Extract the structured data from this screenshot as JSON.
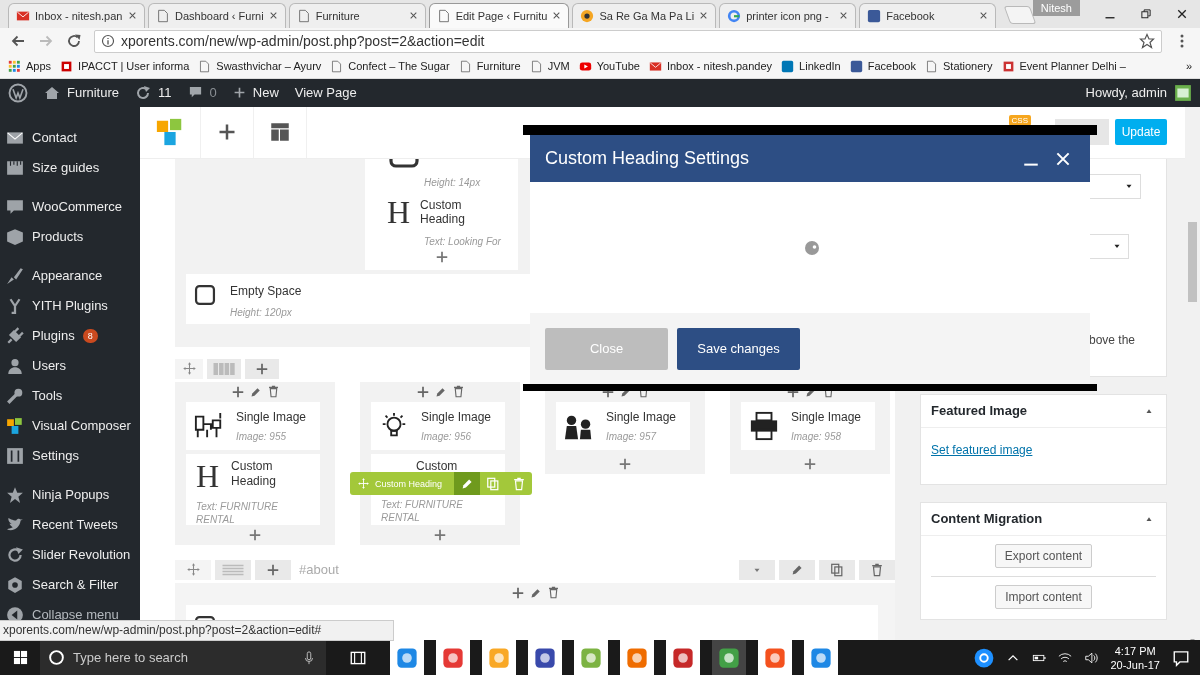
{
  "browser": {
    "tabs": [
      {
        "title": "Inbox - nitesh.pan",
        "selected": false
      },
      {
        "title": "Dashboard ‹ Furni",
        "selected": false
      },
      {
        "title": "Furniture",
        "selected": false
      },
      {
        "title": "Edit Page ‹ Furnitu",
        "selected": true
      },
      {
        "title": "Sa Re Ga Ma Pa Li",
        "selected": false
      },
      {
        "title": "printer icon png -",
        "selected": false
      },
      {
        "title": "Facebook",
        "selected": false
      }
    ],
    "profile": "Nitesh",
    "address": "xporents.com/new/wp-admin/post.php?post=2&action=edit",
    "bookmarks": [
      "Apps",
      "IPACCT | User informa",
      "Swasthvichar – Ayurv",
      "Confect – The Sugar",
      "Furniture",
      "JVM",
      "YouTube",
      "Inbox - nitesh.pandey",
      "LinkedIn",
      "Facebook",
      "Stationery",
      "Event Planner Delhi –"
    ],
    "bookmarks_more": "»"
  },
  "admin_bar": {
    "site": "Furniture",
    "updates": "11",
    "comments": "0",
    "new": "New",
    "view": "View Page",
    "greeting": "Howdy, admin"
  },
  "sidebar": {
    "items": [
      {
        "label": "Contact"
      },
      {
        "label": "Size guides"
      },
      {
        "label": "WooCommerce"
      },
      {
        "label": "Products"
      },
      {
        "label": "Appearance"
      },
      {
        "label": "YITH Plugins"
      },
      {
        "label": "Plugins",
        "badge": "8"
      },
      {
        "label": "Users"
      },
      {
        "label": "Tools"
      },
      {
        "label": "Visual Composer"
      },
      {
        "label": "Settings"
      },
      {
        "label": "Ninja Popups"
      },
      {
        "label": "Recent Tweets"
      },
      {
        "label": "Slider Revolution"
      },
      {
        "label": "Search & Filter"
      },
      {
        "label": "Collapse menu"
      }
    ]
  },
  "builder": {
    "css_badge": "CSS",
    "update": "Update",
    "top_column": {
      "spacer_subtitle": "Height: 14px",
      "heading": {
        "icon_text": "H",
        "title": "Custom Heading",
        "subtitle": "Text: Looking For"
      }
    },
    "empty_space": {
      "title": "Empty Space",
      "subtitle": "Height: 120px"
    },
    "columns": [
      {
        "elements": [
          {
            "kind": "image",
            "title": "Single Image",
            "subtitle": "Image: 955"
          },
          {
            "kind": "heading",
            "icon_text": "H",
            "title": "Custom Heading",
            "subtitle": "Text: FURNITURE RENTAL"
          }
        ]
      },
      {
        "elements": [
          {
            "kind": "image",
            "title": "Single Image",
            "subtitle": "Image: 956"
          },
          {
            "kind": "heading",
            "title": "Custom",
            "subtitle": "Text: FURNITURE RENTAL"
          }
        ]
      },
      {
        "elements": [
          {
            "kind": "image",
            "title": "Single Image",
            "subtitle": "Image: 957"
          }
        ]
      },
      {
        "elements": [
          {
            "kind": "image",
            "title": "Single Image",
            "subtitle": "Image: 958"
          }
        ]
      }
    ],
    "hover_toolbar": {
      "label": "Custom Heading"
    },
    "row_anchor": "#about"
  },
  "modal": {
    "title": "Custom Heading Settings",
    "loading": true,
    "buttons": [
      {
        "label": "Close",
        "kind": "secondary"
      },
      {
        "label": "Save changes",
        "kind": "primary"
      }
    ]
  },
  "side_panel": {
    "partial_text": "bove the",
    "featured": {
      "title": "Featured Image",
      "link": "Set featured image"
    },
    "migration": {
      "title": "Content Migration",
      "buttons": [
        "Export content",
        "Import content"
      ]
    }
  },
  "status_url": "xporents.com/new/wp-admin/post.php?post=2&action=edit#",
  "taskbar": {
    "search_placeholder": "Type here to search",
    "time": "4:17 PM",
    "date": "20-Jun-17"
  }
}
